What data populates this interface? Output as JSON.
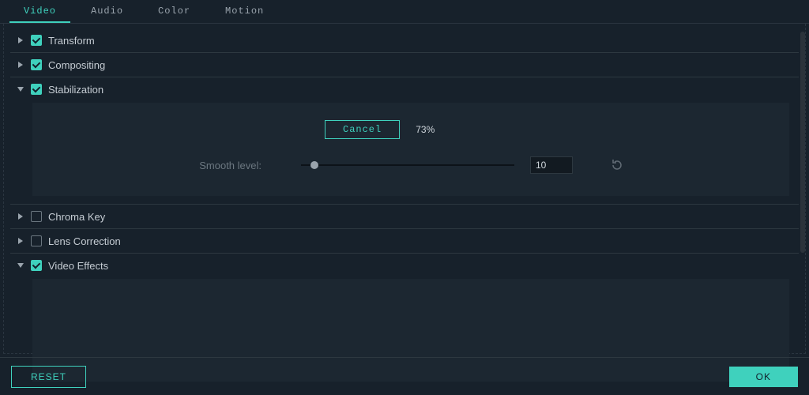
{
  "tabs": {
    "video": "Video",
    "audio": "Audio",
    "color": "Color",
    "motion": "Motion",
    "active": "video"
  },
  "sections": {
    "transform": {
      "label": "Transform",
      "checked": true,
      "expanded": false
    },
    "compositing": {
      "label": "Compositing",
      "checked": true,
      "expanded": false
    },
    "stabilization": {
      "label": "Stabilization",
      "checked": true,
      "expanded": true
    },
    "chroma": {
      "label": "Chroma Key",
      "checked": false,
      "expanded": false
    },
    "lens": {
      "label": "Lens Correction",
      "checked": false,
      "expanded": false
    },
    "effects": {
      "label": "Video Effects",
      "checked": true,
      "expanded": true
    }
  },
  "stabilization": {
    "cancel_label": "Cancel",
    "progress_text": "73%",
    "progress_value": 73,
    "smooth_label": "Smooth level:",
    "smooth_value": "10"
  },
  "footer": {
    "reset": "RESET",
    "ok": "OK"
  },
  "colors": {
    "accent": "#3fd1bd",
    "bg": "#17212b",
    "panel": "#1c2731"
  }
}
